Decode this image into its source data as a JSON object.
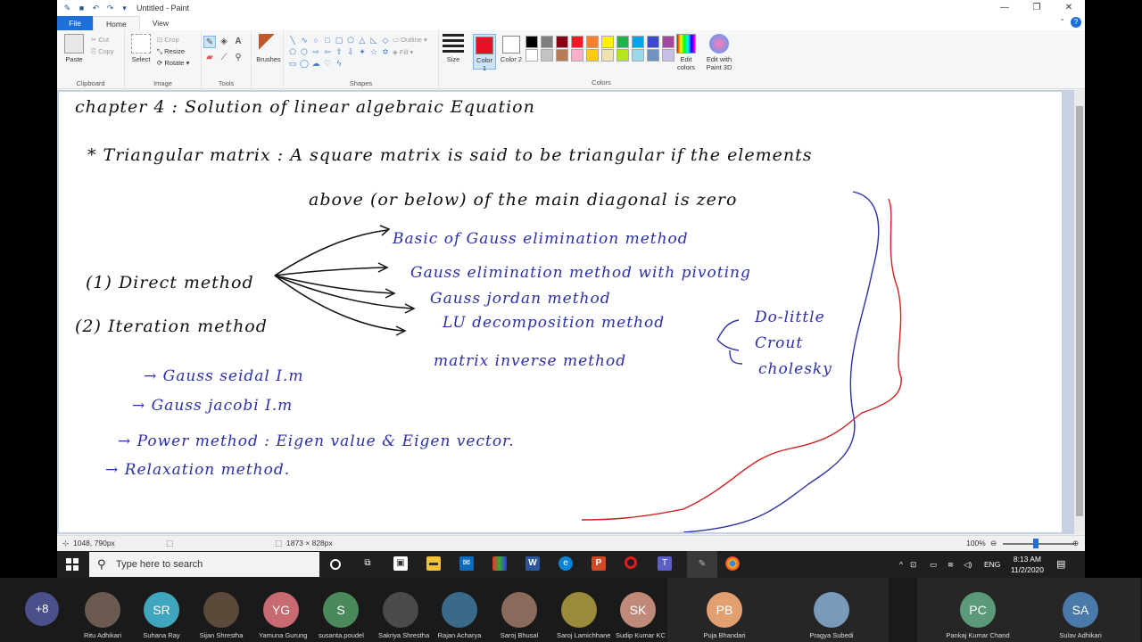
{
  "window": {
    "title": "Untitled - Paint"
  },
  "tabs": {
    "file": "File",
    "home": "Home",
    "view": "View"
  },
  "ribbon": {
    "clipboard": {
      "label": "Clipboard",
      "paste": "Paste",
      "cut": "Cut",
      "copy": "Copy"
    },
    "image": {
      "label": "Image",
      "select": "Select",
      "crop": "Crop",
      "resize": "Resize",
      "rotate": "Rotate"
    },
    "tools": {
      "label": "Tools"
    },
    "brushes": "Brushes",
    "shapes": {
      "label": "Shapes",
      "outline": "Outline",
      "fill": "Fill"
    },
    "size": "Size",
    "color1": "Color 1",
    "color2": "Color 2",
    "colors_label": "Colors",
    "edit_colors": "Edit colors",
    "edit_paint3d": "Edit with Paint 3D",
    "color1_value": "#e81123",
    "color2_value": "#ffffff",
    "palette": [
      "#000000",
      "#7f7f7f",
      "#880015",
      "#ed1c24",
      "#ff7f27",
      "#fff200",
      "#22b14c",
      "#00a2e8",
      "#3f48cc",
      "#a349a4",
      "#ffffff",
      "#c3c3c3",
      "#b97a57",
      "#ffaec9",
      "#ffc90e",
      "#efe4b0",
      "#b5e61d",
      "#99d9ea",
      "#7092be",
      "#c8bfe7"
    ]
  },
  "notes": {
    "title": "chapter 4 : Solution of linear algebraic Equation",
    "tri_def_1": "* Triangular matrix : A square matrix is said to be triangular if the elements",
    "tri_def_2": "above (or below) of the main diagonal is zero",
    "direct": "(1) Direct method",
    "iteration": "(2) Iteration method",
    "m1": "Basic of Gauss elimination method",
    "m2": "Gauss elimination method with pivoting",
    "m3": "Gauss jordan method",
    "m4": "LU decomposition method",
    "m5": "matrix inverse method",
    "lu1": "Do-little",
    "lu2": "Crout",
    "lu3": "cholesky",
    "i1": "→ Gauss seidal I.m",
    "i2": "→ Gauss jacobi I.m",
    "i3": "→ Power method : Eigen value & Eigen vector.",
    "i4": "→ Relaxation method."
  },
  "status": {
    "cursor": "1048, 790px",
    "size": "1873 × 828px",
    "zoom": "100%"
  },
  "taskbar": {
    "search_placeholder": "Type here to search",
    "lang": "ENG",
    "time": "8:13 AM",
    "date": "11/2/2020"
  },
  "participants": {
    "more": "+8",
    "list": [
      {
        "initials": "",
        "name": "Ritu Adhikari",
        "color": "#6a5a50"
      },
      {
        "initials": "SR",
        "name": "Suhana Ray",
        "color": "#3fa6bd"
      },
      {
        "initials": "",
        "name": "Sijan Shrestha",
        "color": "#5a4a3a"
      },
      {
        "initials": "YG",
        "name": "Yamuna Gurung",
        "color": "#c86a72"
      },
      {
        "initials": "S",
        "name": "susanta.poudel",
        "color": "#4a8a5a"
      },
      {
        "initials": "",
        "name": "Sakriya Shrestha",
        "color": "#4a4a4a"
      },
      {
        "initials": "",
        "name": "Rajan Acharya",
        "color": "#3a6a8a"
      },
      {
        "initials": "",
        "name": "Saroj Bhusal",
        "color": "#8a6a5a"
      },
      {
        "initials": "",
        "name": "Saroj Lamichhane",
        "color": "#9a8a3a"
      },
      {
        "initials": "SK",
        "name": "Sudip Kumar KC",
        "color": "#c08a7a"
      },
      {
        "initials": "PB",
        "name": "Puja  Bhandari",
        "color": "#e0a070"
      },
      {
        "initials": "",
        "name": "Pragya Subedi",
        "color": "#7a9aba"
      },
      {
        "initials": "PC",
        "name": "Pankaj Kumar Chand",
        "color": "#5a9a7a"
      },
      {
        "initials": "SA",
        "name": "Sulav Adhikari",
        "color": "#4a7aaa"
      }
    ]
  }
}
